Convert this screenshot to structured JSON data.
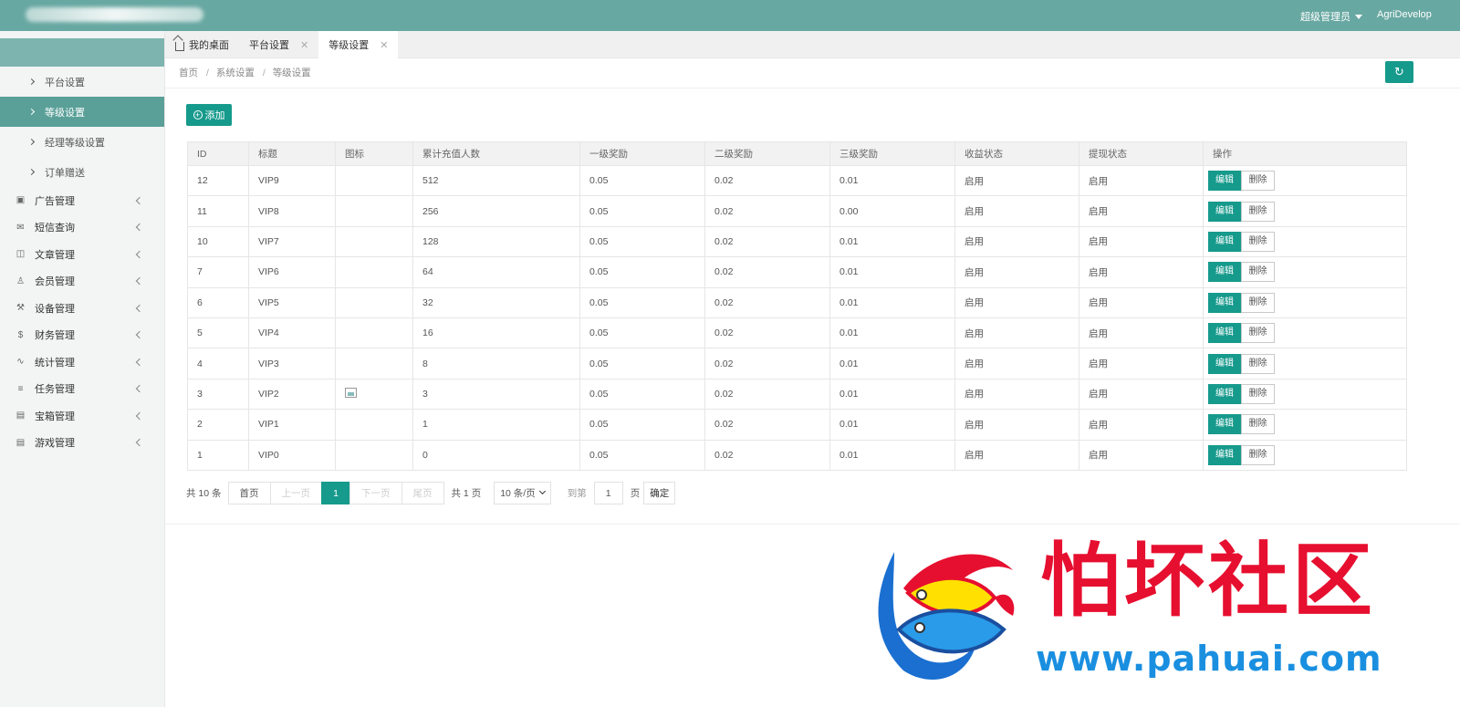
{
  "header": {
    "admin_label": "超级管理员",
    "user_label": "AgriDevelop"
  },
  "sidebar": {
    "sub_items": [
      {
        "label": "平台设置"
      },
      {
        "label": "等级设置"
      },
      {
        "label": "经理等级设置"
      },
      {
        "label": "订单赠送"
      }
    ],
    "items": [
      {
        "label": "广告管理",
        "icon": "image-icon"
      },
      {
        "label": "短信查询",
        "icon": "mail-icon"
      },
      {
        "label": "文章管理",
        "icon": "book-icon"
      },
      {
        "label": "会员管理",
        "icon": "user-icon"
      },
      {
        "label": "设备管理",
        "icon": "tool-icon"
      },
      {
        "label": "财务管理",
        "icon": "dollar-icon"
      },
      {
        "label": "统计管理",
        "icon": "chart-icon"
      },
      {
        "label": "任务管理",
        "icon": "sliders-icon"
      },
      {
        "label": "宝箱管理",
        "icon": "gift-icon"
      },
      {
        "label": "游戏管理",
        "icon": "gift-icon"
      }
    ]
  },
  "tabs": [
    {
      "label": "我的桌面"
    },
    {
      "label": "平台设置"
    },
    {
      "label": "等级设置"
    }
  ],
  "breadcrumb": [
    "首页",
    "系统设置",
    "等级设置"
  ],
  "toolbar": {
    "add_label": "添加"
  },
  "table": {
    "headers": [
      "ID",
      "标题",
      "图标",
      "累计充值人数",
      "一级奖励",
      "二级奖励",
      "三级奖励",
      "收益状态",
      "提现状态",
      "操作"
    ],
    "edit_label": "编辑",
    "delete_label": "删除",
    "rows": [
      {
        "id": "12",
        "title": "VIP9",
        "count": "512",
        "l1": "0.05",
        "l2": "0.02",
        "l3": "0.01",
        "income": "启用",
        "withdraw": "启用"
      },
      {
        "id": "11",
        "title": "VIP8",
        "count": "256",
        "l1": "0.05",
        "l2": "0.02",
        "l3": "0.00",
        "income": "启用",
        "withdraw": "启用"
      },
      {
        "id": "10",
        "title": "VIP7",
        "count": "128",
        "l1": "0.05",
        "l2": "0.02",
        "l3": "0.01",
        "income": "启用",
        "withdraw": "启用"
      },
      {
        "id": "7",
        "title": "VIP6",
        "count": "64",
        "l1": "0.05",
        "l2": "0.02",
        "l3": "0.01",
        "income": "启用",
        "withdraw": "启用"
      },
      {
        "id": "6",
        "title": "VIP5",
        "count": "32",
        "l1": "0.05",
        "l2": "0.02",
        "l3": "0.01",
        "income": "启用",
        "withdraw": "启用"
      },
      {
        "id": "5",
        "title": "VIP4",
        "count": "16",
        "l1": "0.05",
        "l2": "0.02",
        "l3": "0.01",
        "income": "启用",
        "withdraw": "启用"
      },
      {
        "id": "4",
        "title": "VIP3",
        "count": "8",
        "l1": "0.05",
        "l2": "0.02",
        "l3": "0.01",
        "income": "启用",
        "withdraw": "启用"
      },
      {
        "id": "3",
        "title": "VIP2",
        "count": "3",
        "l1": "0.05",
        "l2": "0.02",
        "l3": "0.01",
        "income": "启用",
        "withdraw": "启用",
        "has_icon": true
      },
      {
        "id": "2",
        "title": "VIP1",
        "count": "1",
        "l1": "0.05",
        "l2": "0.02",
        "l3": "0.01",
        "income": "启用",
        "withdraw": "启用"
      },
      {
        "id": "1",
        "title": "VIP0",
        "count": "0",
        "l1": "0.05",
        "l2": "0.02",
        "l3": "0.01",
        "income": "启用",
        "withdraw": "启用"
      }
    ]
  },
  "pagination": {
    "total_label": "共 10 条",
    "first": "首页",
    "prev": "上一页",
    "current": "1",
    "next": "下一页",
    "last": "尾页",
    "pages_label": "共 1 页",
    "page_size": "10 条/页",
    "goto_label": "到第",
    "goto_value": "1",
    "page_unit": "页",
    "confirm": "确定"
  },
  "watermark": {
    "title": "怕坏社区",
    "url": "www.pahuai.com"
  },
  "colors": {
    "header": "#68a8a2",
    "primary": "#169a8c",
    "status_green": "#5fb878",
    "watermark_red": "#e60f2f",
    "watermark_blue": "#1a8fe0"
  }
}
